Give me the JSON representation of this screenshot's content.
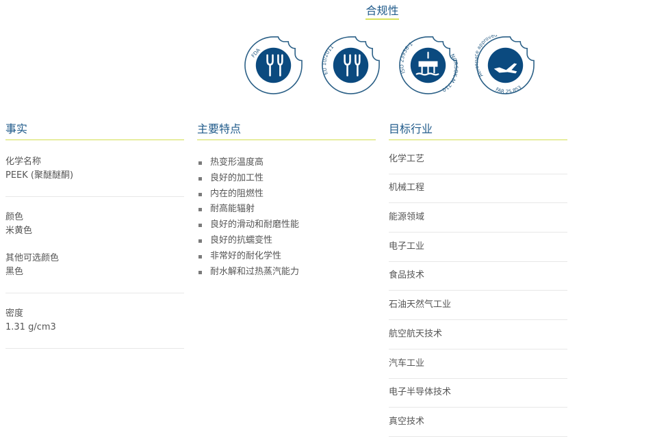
{
  "compliance": {
    "title": "合规性",
    "badges": [
      {
        "name": "fda-badge",
        "label": "FDA",
        "icon": "fork-knife-icon"
      },
      {
        "name": "eu-10-2011-badge",
        "label": "EU 10/2011",
        "icon": "fork-knife-icon"
      },
      {
        "name": "iso-23936-badge",
        "label": "ISO 23936-1",
        "label2": "NORSOK M-710",
        "icon": "oil-platform-icon"
      },
      {
        "name": "aerospace-badge",
        "label": "Aerospace approved",
        "label2": "FAR 25.853",
        "icon": "airplane-icon"
      }
    ],
    "brand_color": "#0b4a7f",
    "accent_color": "#d8e35a"
  },
  "facts": {
    "heading": "事实",
    "chemical_name_label": "化学名称",
    "chemical_name_value": "PEEK (聚醚醚酮)",
    "color_label": "颜色",
    "color_value": "米黄色",
    "alt_color_label": "其他可选颜色",
    "alt_color_value": "黑色",
    "density_label": "密度",
    "density_value": "1.31 g/cm3"
  },
  "features": {
    "heading": "主要特点",
    "items": [
      "热变形温度高",
      "良好的加工性",
      "内在的阻燃性",
      "耐高能辐射",
      "良好的滑动和耐磨性能",
      "良好的抗蠕变性",
      "非常好的耐化学性",
      "耐水解和过热蒸汽能力"
    ]
  },
  "industries": {
    "heading": "目标行业",
    "items": [
      "化学工艺",
      "机械工程",
      "能源领域",
      "电子工业",
      "食品技术",
      "石油天然气工业",
      "航空航天技术",
      "汽车工业",
      "电子半导体技术",
      "真空技术"
    ]
  }
}
